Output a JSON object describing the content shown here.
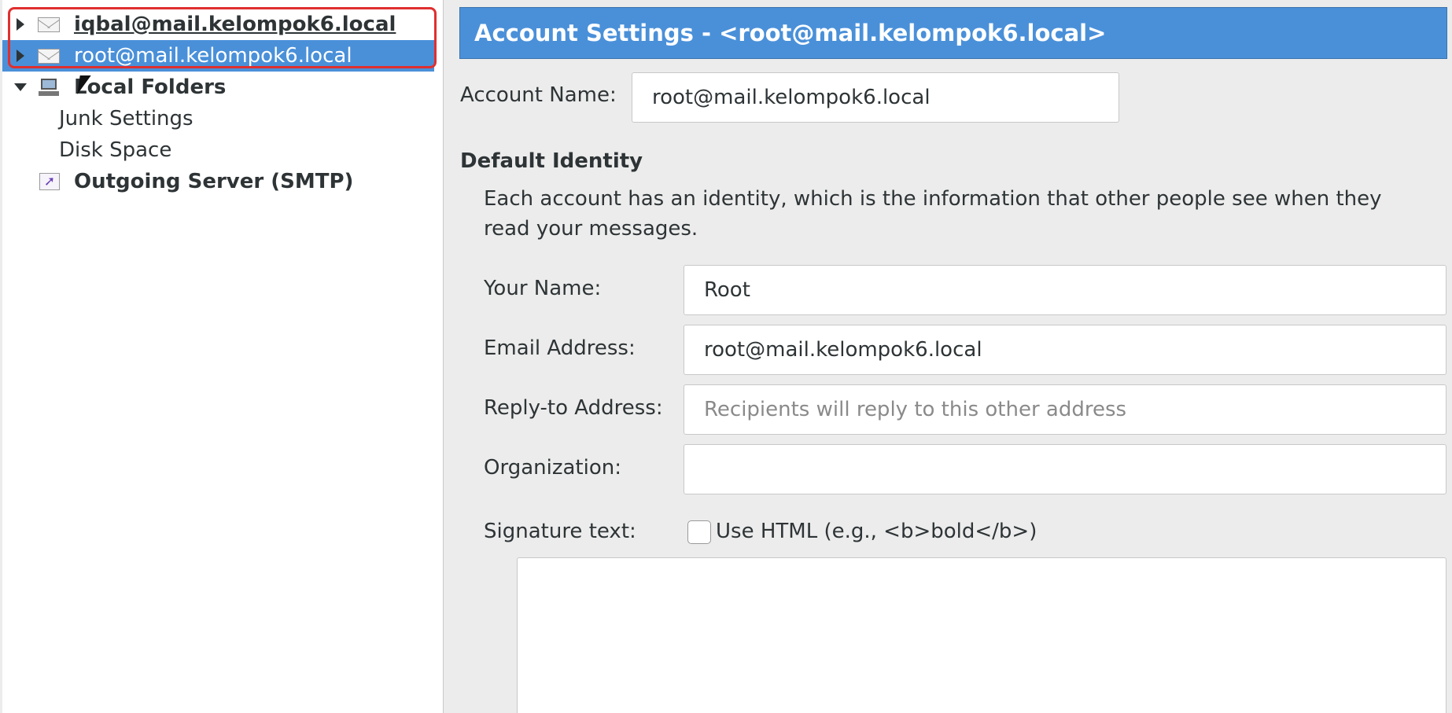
{
  "tree": {
    "accounts": [
      {
        "label": "iqbal@mail.kelompok6.local",
        "icon": "mail-icon"
      },
      {
        "label": "root@mail.kelompok6.local",
        "icon": "mail-icon"
      }
    ],
    "local_folders": {
      "label": "Local Folders",
      "icon": "computer-icon",
      "children": [
        "Junk Settings",
        "Disk Space"
      ]
    },
    "outgoing_server": {
      "label": "Outgoing Server (SMTP)",
      "icon": "smtp-icon"
    }
  },
  "settings": {
    "header": "Account Settings - <root@mail.kelompok6.local>",
    "account_name": {
      "label": "Account Name:",
      "value": "root@mail.kelompok6.local"
    },
    "default_identity": {
      "title": "Default Identity",
      "description": "Each account has an identity, which is the information that other people see when they read your messages.",
      "your_name": {
        "label": "Your Name:",
        "value": "Root"
      },
      "email": {
        "label": "Email Address:",
        "value": "root@mail.kelompok6.local"
      },
      "reply_to": {
        "label": "Reply-to Address:",
        "placeholder": "Recipients will reply to this other address"
      },
      "organization": {
        "label": "Organization:",
        "value": ""
      },
      "signature": {
        "label": "Signature text:",
        "use_html_label": "Use HTML (e.g., <b>bold</b>)",
        "use_html_checked": false,
        "value": ""
      }
    }
  },
  "colors": {
    "selection": "#4a90d9",
    "focus_ring": "#e02f2f"
  }
}
